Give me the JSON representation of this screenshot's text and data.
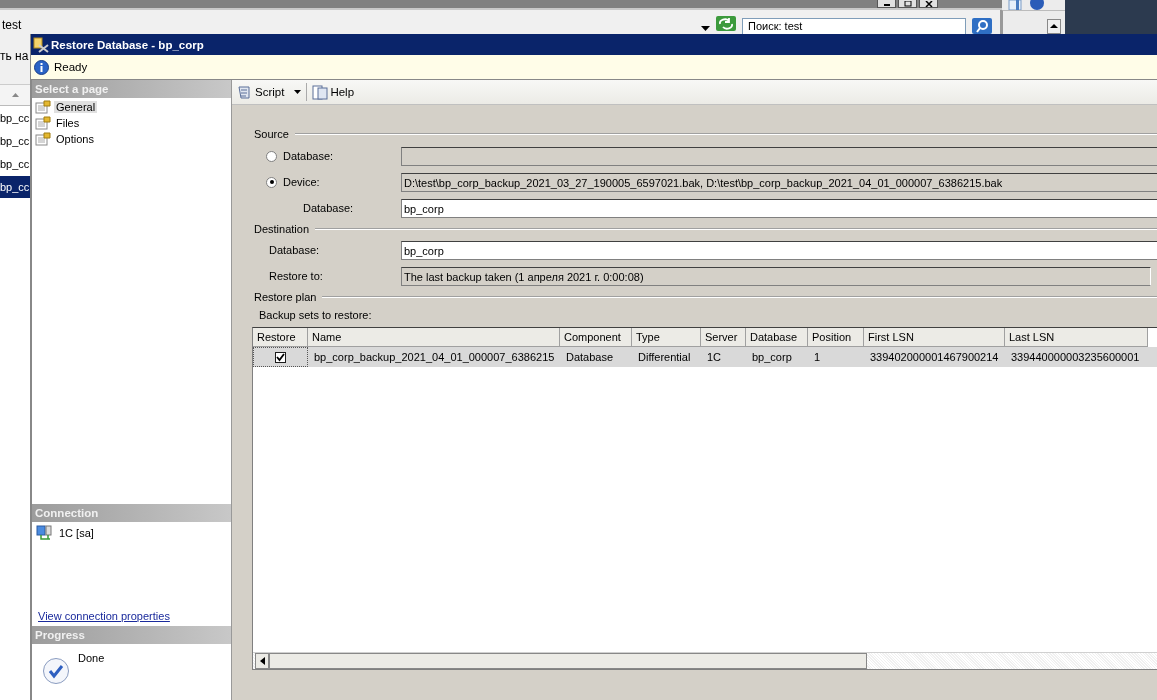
{
  "background_app": {
    "toolbar_text": "test",
    "search": {
      "value": "Поиск: test"
    },
    "sidebar_fragment": "ть на",
    "list_items": [
      {
        "label": "bp_cc",
        "selected": false
      },
      {
        "label": "bp_cc",
        "selected": false
      },
      {
        "label": "bp_cc",
        "selected": false
      },
      {
        "label": "bp_cc",
        "selected": true
      }
    ]
  },
  "window": {
    "title": "Restore Database - bp_corp"
  },
  "status": {
    "kind": "info",
    "text": "Ready"
  },
  "select_page": {
    "header": "Select a page",
    "items": [
      {
        "label": "General",
        "selected": true
      },
      {
        "label": "Files",
        "selected": false
      },
      {
        "label": "Options",
        "selected": false
      }
    ]
  },
  "connection": {
    "header": "Connection",
    "server": "1C [sa]",
    "link": "View connection properties"
  },
  "progress": {
    "header": "Progress",
    "status": "Done"
  },
  "toolbar": {
    "buttons": [
      {
        "label": "Script",
        "kind": "dropdown"
      },
      {
        "label": "Help",
        "kind": "plain"
      }
    ]
  },
  "source": {
    "title": "Source",
    "options": [
      {
        "label": "Database:",
        "selected": false
      },
      {
        "label": "Device:",
        "selected": true,
        "value": "D:\\test\\bp_corp_backup_2021_03_27_190005_6597021.bak, D:\\test\\bp_corp_backup_2021_04_01_000007_6386215.bak"
      }
    ],
    "database": {
      "label": "Database:",
      "value": "bp_corp"
    }
  },
  "destination": {
    "title": "Destination",
    "fields": [
      {
        "label": "Database:",
        "value": "bp_corp",
        "editable": true
      },
      {
        "label": "Restore to:",
        "value": "The last backup taken (1 апреля 2021 г. 0:00:08)",
        "editable": false
      }
    ]
  },
  "restore_plan": {
    "title": "Restore plan",
    "label": "Backup sets to restore:",
    "table": {
      "checkbox_column": "Restore",
      "columns": [
        "Name",
        "Component",
        "Type",
        "Server",
        "Database",
        "Position",
        "First LSN",
        "Last LSN"
      ],
      "rows": [
        {
          "restore": true,
          "cells": [
            "bp_corp_backup_2021_04_01_000007_6386215",
            "Database",
            "Differential",
            "1C",
            "bp_corp",
            "1",
            "339402000001467900214",
            "339440000003235600001"
          ]
        }
      ]
    }
  }
}
